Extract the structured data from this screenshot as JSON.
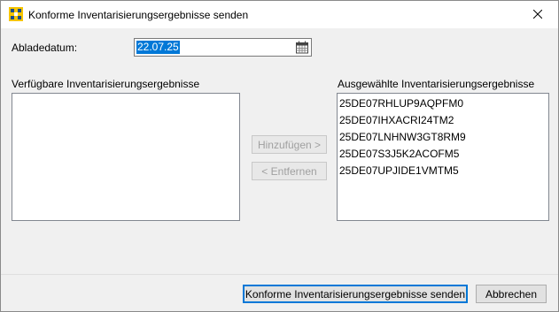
{
  "window": {
    "title": "Konforme Inventarisierungsergebnisse senden"
  },
  "icons": {
    "app": "app-grid-icon",
    "close": "close-icon",
    "calendar": "calendar-icon"
  },
  "form": {
    "date_label": "Abladedatum:",
    "date_value": "22.07.25"
  },
  "available": {
    "header": "Verfügbare Inventarisierungsergebnisse",
    "items": []
  },
  "selected": {
    "header": "Ausgewählte Inventarisierungsergebnisse",
    "items": [
      "25DE07RHLUP9AQPFM0",
      "25DE07IHXACRI24TM2",
      "25DE07LNHNW3GT8RM9",
      "25DE07S3J5K2ACOFM5",
      "25DE07UPJIDE1VMTM5"
    ]
  },
  "buttons": {
    "add": "Hinzufügen >",
    "remove": "< Entfernen",
    "send": "Konforme Inventarisierungsergebnisse senden",
    "cancel": "Abbrechen"
  },
  "colors": {
    "accent": "#0078d7",
    "icon_yellow": "#f5c400",
    "disabled_text": "#a0a0a0"
  }
}
